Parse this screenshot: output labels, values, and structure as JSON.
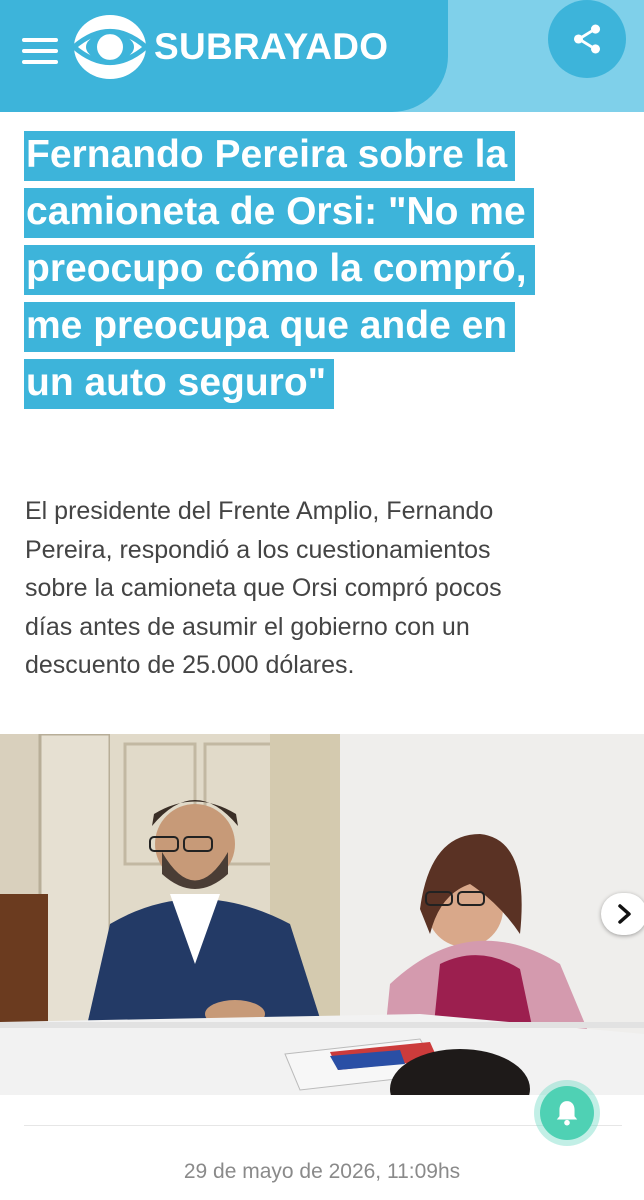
{
  "header": {
    "brand": "SUBRAYADO",
    "menu_icon": "hamburger-menu-icon",
    "logo_icon": "eye-logo-icon",
    "share_icon": "share-icon",
    "colors": {
      "brand_blue": "#3db4da",
      "bar_light": "#7fd0ea"
    }
  },
  "article": {
    "title_lines": [
      "Fernando Pereira sobre la",
      "camioneta de Orsi: \"No me",
      "preocupo cómo la compró,",
      "me preocupa que ande en",
      "un auto seguro\""
    ],
    "lead_lines": [
      "El presidente del Frente Amplio, Fernando",
      "Pereira, respondió a los cuestionamientos",
      "sobre la camioneta que Orsi compró pocos",
      "días antes de asumir el gobierno con un",
      "descuento de 25.000 dólares."
    ],
    "photo_icon": "news-photo-image",
    "next_icon": "chevron-right-icon",
    "date": "29 de mayo de 2026, 11:09hs"
  },
  "notifications": {
    "bell_icon": "bell-icon",
    "color": "#4fd1b4"
  }
}
